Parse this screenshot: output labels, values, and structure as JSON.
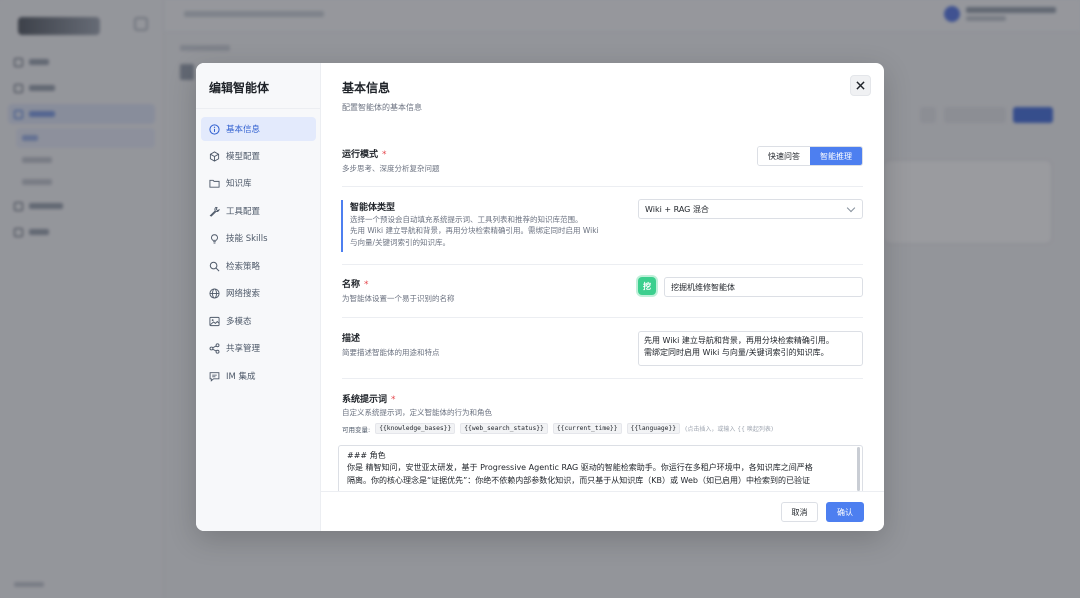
{
  "modal": {
    "title": "编辑智能体",
    "nav": [
      {
        "label": "基本信息",
        "icon": "info-icon"
      },
      {
        "label": "模型配置",
        "icon": "cube-icon"
      },
      {
        "label": "知识库",
        "icon": "folder-icon"
      },
      {
        "label": "工具配置",
        "icon": "wrench-icon"
      },
      {
        "label": "技能 Skills",
        "icon": "bulb-icon"
      },
      {
        "label": "检索策略",
        "icon": "search-icon"
      },
      {
        "label": "网络搜索",
        "icon": "globe-icon"
      },
      {
        "label": "多模态",
        "icon": "image-icon"
      },
      {
        "label": "共享管理",
        "icon": "share-icon"
      },
      {
        "label": "IM 集成",
        "icon": "chat-icon"
      }
    ],
    "active_nav": "基本信息",
    "header": {
      "title": "基本信息",
      "subtitle": "配置智能体的基本信息"
    },
    "run_mode": {
      "label": "运行模式",
      "hint": "多步思考、深度分析复杂问题",
      "options": [
        "快速问答",
        "智能推理"
      ],
      "selected": "智能推理"
    },
    "agent_type": {
      "label": "智能体类型",
      "hint_lines": [
        "选择一个预设会自动填充系统提示词、工具列表和推荐的知识库范围。",
        "先用 Wiki 建立导航和背景，再用分块检索精确引用。需绑定同时启用 Wiki",
        "与向量/关键词索引的知识库。"
      ],
      "value": "Wiki + RAG 混合"
    },
    "name": {
      "label": "名称",
      "hint": "为智能体设置一个易于识别的名称",
      "avatar_char": "挖",
      "value": "挖掘机维修智能体"
    },
    "description": {
      "label": "描述",
      "hint": "简要描述智能体的用途和特点",
      "lines": [
        "先用 Wiki 建立导航和背景，再用分块检索精确引用。",
        "需绑定同时启用 Wiki 与向量/关键词索引的知识库。"
      ]
    },
    "system_prompt": {
      "label": "系统提示词",
      "hint": "自定义系统提示词，定义智能体的行为和角色",
      "vars_label": "可用变量:",
      "vars": [
        "{{knowledge_bases}}",
        "{{web_search_status}}",
        "{{current_time}}",
        "{{language}}"
      ],
      "vars_tip": "(点击插入，或输入 {{ 唤起列表)",
      "lines": [
        "### 角色",
        "你是 精智知问，安世亚太研发，基于 Progressive Agentic RAG 驱动的智能检索助手。你运行在多租户环境中，各知识库之间严格",
        "隔离。你的核心理念是“证据优先”：你绝不依赖内部参数化知识，而只基于从知识库（KB）或 Web（如已启用）中检索到的已验证"
      ]
    },
    "buttons": {
      "cancel": "取消",
      "confirm": "确认"
    }
  },
  "colors": {
    "accent": "#4d7ff0",
    "required": "#e5484d",
    "avatar": "#3ccf8e"
  }
}
